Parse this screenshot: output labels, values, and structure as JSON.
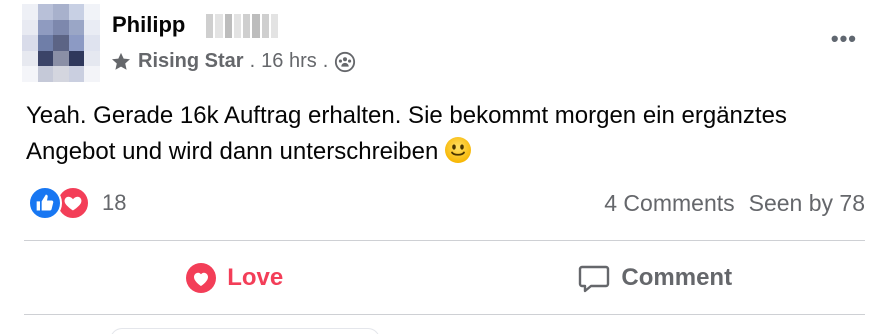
{
  "post": {
    "author": "Philipp",
    "badge": "Rising Star",
    "separator_1": ".",
    "time": "16 hrs",
    "separator_2": ".",
    "audience_icon": "group-icon",
    "more_icon": "more-options-icon",
    "text": "Yeah. Gerade 16k Auftrag erhalten. Sie bekommt morgen ein ergänztes Angebot und wird dann unterschreiben",
    "emoji": "slightly-smiling-face-emoji"
  },
  "reactions": {
    "icons": [
      "like-icon",
      "love-icon"
    ],
    "count": "18"
  },
  "stats": {
    "comments": "4 Comments",
    "seen_by": "Seen by 78"
  },
  "actions": {
    "love_label": "Love",
    "comment_label": "Comment"
  },
  "colors": {
    "love": "#f33e58",
    "like": "#1877f2",
    "muted": "#65676b",
    "text": "#050505",
    "divider": "#ced0d4"
  }
}
